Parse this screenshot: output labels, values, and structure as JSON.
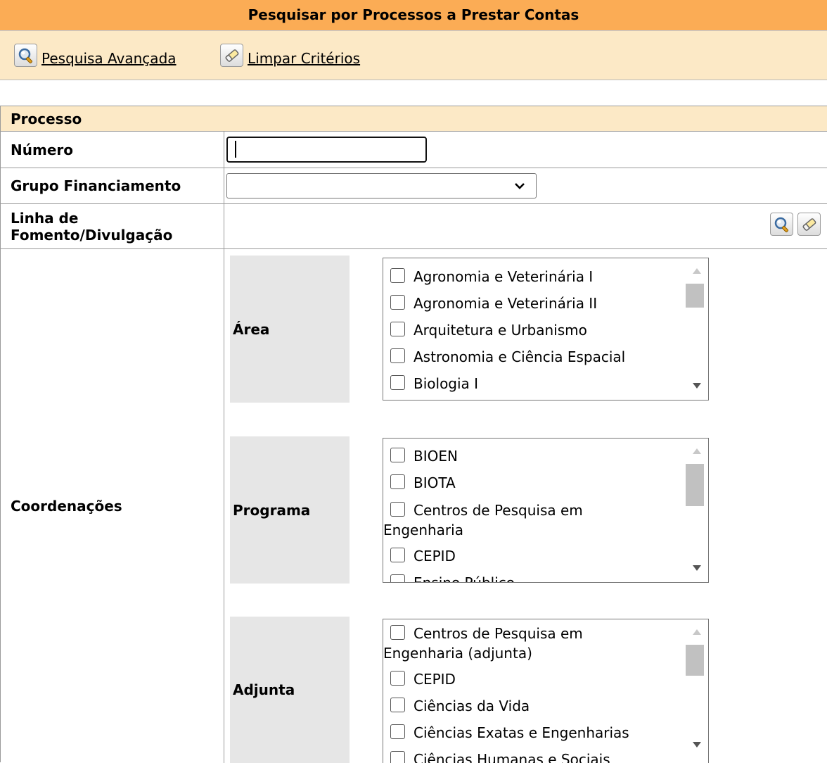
{
  "header": {
    "title": "Pesquisar por Processos a Prestar Contas",
    "advanced_search_label": "Pesquisa Avançada",
    "clear_criteria_label": "Limpar Critérios"
  },
  "form": {
    "section_title": "Processo",
    "numero": {
      "label": "Número",
      "value": ""
    },
    "grupo": {
      "label": "Grupo Financiamento",
      "selected": ""
    },
    "linha": {
      "label_line1": "Linha de",
      "label_line2": "Fomento/Divulgação"
    },
    "coordenacoes": {
      "label": "Coordenações",
      "area": {
        "label": "Área",
        "options": [
          "Agronomia e Veterinária I",
          "Agronomia e Veterinária II",
          "Arquitetura e Urbanismo",
          "Astronomia e Ciência Espacial",
          "Biologia I"
        ]
      },
      "programa": {
        "label": "Programa",
        "options": [
          "BIOEN",
          "BIOTA",
          "Centros de Pesquisa em",
          "CEPID",
          "Ensino Público"
        ],
        "option_wrap": "Engenharia"
      },
      "adjunta": {
        "label": "Adjunta",
        "options": [
          "Centros de Pesquisa em",
          "CEPID",
          "Ciências da Vida",
          "Ciências Exatas e Engenharias",
          "Ciências Humanas e Sociais"
        ],
        "option_wrap": "Engenharia (adjunta)"
      }
    }
  },
  "icons": {
    "search": "magnifier-icon",
    "clear": "eraser-icon"
  }
}
